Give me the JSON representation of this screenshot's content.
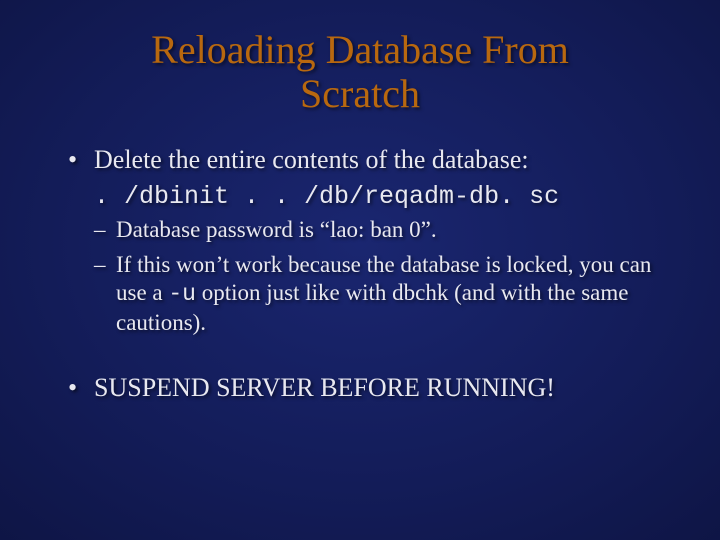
{
  "title_line1": "Reloading Database From",
  "title_line2": "Scratch",
  "bullets": {
    "b1": "Delete the entire contents of the database:",
    "cmd": ". /dbinit . . /db/reqadm-db. sc",
    "sub1": "Database password is “lao: ban 0”.",
    "sub2_before": "If this won’t work because the database is locked, you can use a ",
    "sub2_flag": "-u",
    "sub2_after": " option just like with dbchk (and with the same cautions).",
    "b2": "SUSPEND SERVER BEFORE RUNNING!"
  }
}
